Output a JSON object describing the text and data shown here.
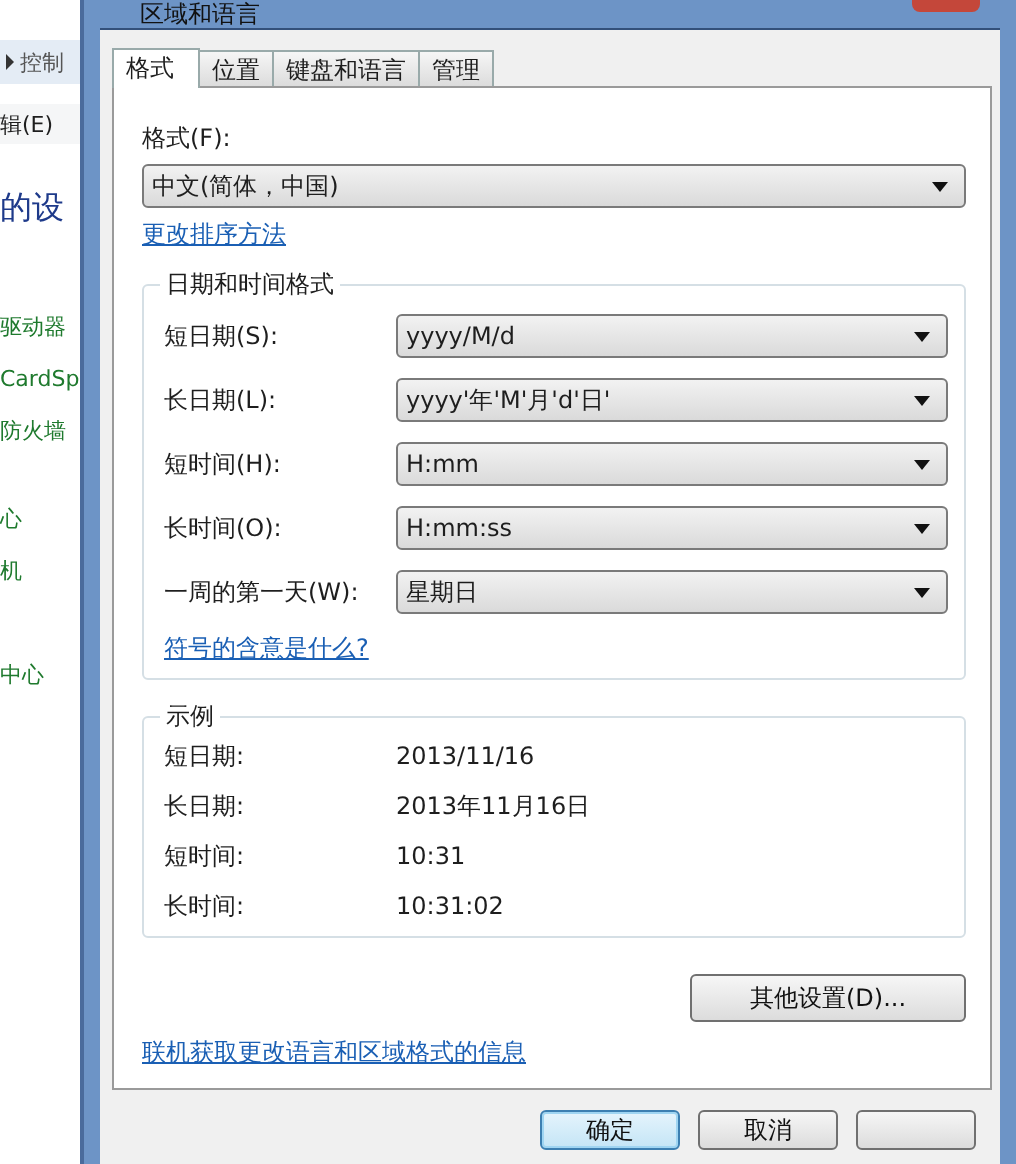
{
  "background_window": {
    "breadcrumb": "控制",
    "menu": [
      "辑(E)"
    ],
    "heading": "的设",
    "links": [
      "驱动器",
      "CardSp",
      "防火墙",
      "心",
      "机",
      "中心"
    ]
  },
  "window": {
    "title": "区域和语言"
  },
  "tabs": [
    {
      "label": "格式",
      "selected": true
    },
    {
      "label": "位置",
      "selected": false
    },
    {
      "label": "键盘和语言",
      "selected": false
    },
    {
      "label": "管理",
      "selected": false
    }
  ],
  "format": {
    "label": "格式(F):",
    "value": "中文(简体，中国)"
  },
  "sort_link": "更改排序方法",
  "date_time_group": {
    "title": "日期和时间格式",
    "fields": [
      {
        "label": "短日期(S):",
        "value": "yyyy/M/d"
      },
      {
        "label": "长日期(L):",
        "value": "yyyy'年'M'月'd'日'"
      },
      {
        "label": "短时间(H):",
        "value": "H:mm"
      },
      {
        "label": "长时间(O):",
        "value": "H:mm:ss"
      },
      {
        "label": "一周的第一天(W):",
        "value": "星期日"
      }
    ],
    "link": "符号的含意是什么?"
  },
  "example_group": {
    "title": "示例",
    "rows": [
      {
        "label": "短日期:",
        "value": "2013/11/16"
      },
      {
        "label": "长日期:",
        "value": "2013年11月16日"
      },
      {
        "label": "短时间:",
        "value": "10:31"
      },
      {
        "label": "长时间:",
        "value": "10:31:02"
      }
    ]
  },
  "more_button": "其他设置(D)...",
  "online_link": "联机获取更改语言和区域格式的信息",
  "buttons": [
    {
      "label": "确定",
      "default": true
    },
    {
      "label": "取消",
      "default": false
    }
  ]
}
